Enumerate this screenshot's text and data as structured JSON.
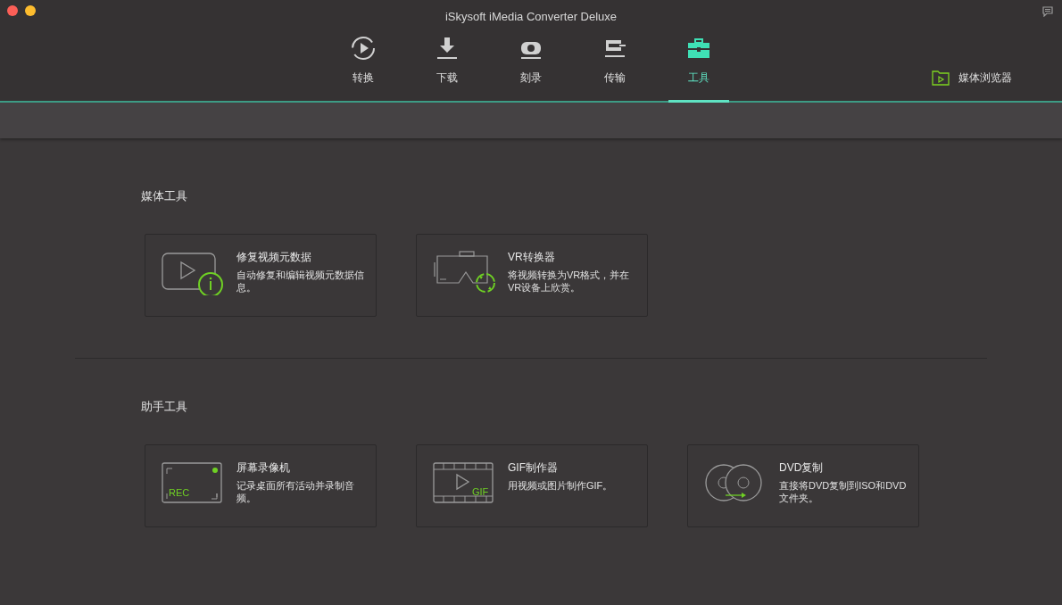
{
  "window": {
    "title": "iSkysoft iMedia Converter Deluxe"
  },
  "tabs": [
    {
      "label": "转换",
      "kind": "convert",
      "selected": false
    },
    {
      "label": "下载",
      "kind": "download",
      "selected": false
    },
    {
      "label": "刻录",
      "kind": "burn",
      "selected": false
    },
    {
      "label": "传输",
      "kind": "transfer",
      "selected": false
    },
    {
      "label": "工具",
      "kind": "toolbox",
      "selected": true
    }
  ],
  "media_browser": {
    "label": "媒体浏览器"
  },
  "sections": [
    {
      "title": "媒体工具",
      "tools": [
        {
          "kind": "video-info",
          "title": "修复视频元数据",
          "description": "自动修复和编辑视频元数据信息。"
        },
        {
          "kind": "vr",
          "title": "VR转换器",
          "description": "将视频转换为VR格式，并在VR设备上欣赏。"
        }
      ]
    },
    {
      "title": "助手工具",
      "tools": [
        {
          "kind": "rec",
          "icon_text": "REC",
          "title": "屏幕录像机",
          "description": "记录桌面所有活动并录制音频。"
        },
        {
          "kind": "gif",
          "icon_text": "GIF",
          "title": "GIF制作器",
          "description": "用视频或图片制作GIF。"
        },
        {
          "kind": "dvd",
          "title": "DVD复制",
          "description": "直接将DVD复制到ISO和DVD文件夹。"
        }
      ]
    }
  ]
}
